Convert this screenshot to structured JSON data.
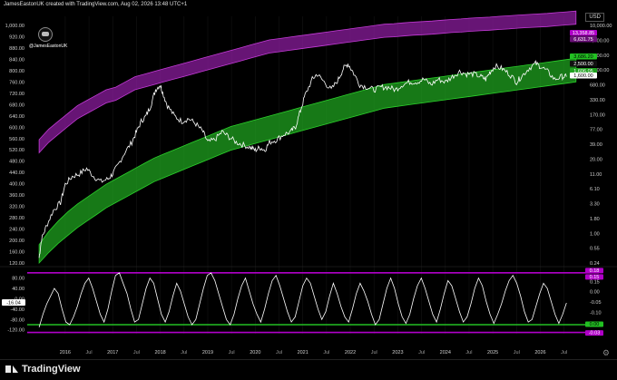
{
  "header": {
    "attribution": "JamesEastonUK created with TradingView.com, Aug 02, 2026 13:48 UTC+1"
  },
  "currency_badge": "USD",
  "avatar": {
    "handle": "@JamesEastonUK"
  },
  "footer": {
    "brand": "TradingView"
  },
  "colors": {
    "purple_band": "#8a1c9c",
    "green_band": "#1fa11f",
    "price": "#ffffff",
    "purple_line": "#b000c8",
    "green_line": "#22c022"
  },
  "chart_data": [
    {
      "type": "line",
      "title": "",
      "x": [
        2015.45,
        2015.5,
        2015.6,
        2015.75,
        2015.9,
        2016.0,
        2016.15,
        2016.3,
        2016.45,
        2016.6,
        2016.75,
        2016.9,
        2017.0,
        2017.1,
        2017.25,
        2017.4,
        2017.5,
        2017.6,
        2017.7,
        2017.8,
        2017.9,
        2018.0,
        2018.05,
        2018.15,
        2018.3,
        2018.45,
        2018.6,
        2018.75,
        2018.9,
        2019.0,
        2019.15,
        2019.3,
        2019.45,
        2019.6,
        2019.75,
        2019.9,
        2020.0,
        2020.1,
        2020.2,
        2020.3,
        2020.45,
        2020.6,
        2020.75,
        2020.85,
        2020.95,
        2021.05,
        2021.2,
        2021.3,
        2021.45,
        2021.6,
        2021.75,
        2021.85,
        2021.95,
        2022.05,
        2022.2,
        2022.35,
        2022.5,
        2022.65,
        2022.8,
        2022.95,
        2023.1,
        2023.25,
        2023.4,
        2023.55,
        2023.7,
        2023.85,
        2024.0,
        2024.15,
        2024.3,
        2024.45,
        2024.6,
        2024.75,
        2024.85,
        2024.95,
        2025.05,
        2025.2,
        2025.35,
        2025.5,
        2025.6,
        2025.75,
        2025.9,
        2026.0,
        2026.15,
        2026.3,
        2026.45,
        2026.55
      ],
      "series": [
        {
          "values": [
            120,
            190,
            240,
            300,
            330,
            400,
            430,
            440,
            460,
            430,
            410,
            420,
            440,
            470,
            520,
            560,
            600,
            640,
            660,
            700,
            760,
            780,
            750,
            700,
            660,
            640,
            650,
            630,
            600,
            560,
            570,
            600,
            580,
            560,
            550,
            540,
            530,
            540,
            530,
            560,
            570,
            590,
            600,
            620,
            680,
            740,
            800,
            820,
            790,
            760,
            800,
            840,
            860,
            830,
            780,
            770,
            760,
            770,
            770,
            760,
            780,
            790,
            790,
            800,
            780,
            800,
            790,
            810,
            830,
            820,
            820,
            810,
            800,
            830,
            850,
            840,
            820,
            790,
            810,
            840,
            860,
            850,
            830,
            800,
            810,
            810
          ]
        }
      ],
      "bands": [
        {
          "lower": [
            520,
            560,
            590,
            620,
            650,
            670,
            690,
            710,
            720,
            740,
            760,
            770,
            780,
            790,
            800,
            810,
            820,
            830,
            840,
            850,
            860,
            870,
            880,
            890,
            900,
            905,
            910,
            915,
            920,
            925,
            930,
            935,
            940,
            945,
            950,
            955,
            960,
            962,
            965,
            968,
            970,
            972,
            975,
            978,
            980,
            983,
            985,
            987,
            990,
            992,
            995,
            997,
            999,
            1001,
            1004,
            1007,
            1010
          ],
          "upper": [
            570,
            610,
            640,
            670,
            700,
            720,
            740,
            760,
            770,
            790,
            810,
            820,
            830,
            840,
            850,
            860,
            870,
            880,
            890,
            900,
            910,
            920,
            930,
            940,
            950,
            955,
            960,
            965,
            970,
            975,
            980,
            985,
            990,
            995,
            1000,
            1005,
            1010,
            1012,
            1015,
            1018,
            1020,
            1022,
            1025,
            1028,
            1030,
            1033,
            1035,
            1037,
            1040,
            1042,
            1045,
            1047,
            1049,
            1051,
            1054,
            1057,
            1060
          ]
        },
        {
          "lower": [
            100,
            140,
            175,
            205,
            235,
            260,
            285,
            310,
            330,
            350,
            370,
            390,
            410,
            425,
            440,
            455,
            470,
            485,
            500,
            515,
            530,
            540,
            550,
            560,
            570,
            580,
            590,
            600,
            610,
            620,
            630,
            640,
            650,
            660,
            670,
            680,
            690,
            695,
            700,
            705,
            710,
            715,
            720,
            725,
            730,
            735,
            740,
            745,
            750,
            755,
            760,
            765,
            770,
            775,
            780,
            785,
            790
          ],
          "upper": [
            170,
            220,
            260,
            295,
            325,
            350,
            375,
            400,
            420,
            440,
            460,
            480,
            500,
            515,
            530,
            545,
            560,
            575,
            590,
            605,
            620,
            630,
            640,
            650,
            660,
            670,
            680,
            690,
            700,
            710,
            720,
            730,
            740,
            750,
            760,
            770,
            780,
            785,
            790,
            795,
            800,
            805,
            810,
            815,
            820,
            825,
            830,
            835,
            840,
            845,
            850,
            855,
            860,
            865,
            870,
            875,
            880
          ]
        }
      ],
      "band_x_start": 2015.45,
      "band_x_end": 2026.75,
      "yticks_left": [
        "1,000.00",
        "920.00",
        "880.00",
        "840.00",
        "800.00",
        "760.00",
        "720.00",
        "680.00",
        "640.00",
        "600.00",
        "560.00",
        "520.00",
        "480.00",
        "440.00",
        "400.00",
        "360.00",
        "320.00",
        "280.00",
        "240.00",
        "200.00",
        "160.00",
        "120.00"
      ],
      "yticks_right": [
        "10,000.00",
        "5,000.00",
        "2,500.00",
        "1,300.00",
        "680.00",
        "330.00",
        "170.00",
        "77.00",
        "39.00",
        "20.00",
        "11.00",
        "6.10",
        "3.30",
        "1.80",
        "1.00",
        "0.55",
        "0.24"
      ],
      "price_labels": [
        {
          "text": "13,358.85",
          "color": "#b000c8"
        },
        {
          "text": "6,631.75",
          "color": "#6a1078"
        },
        {
          "text": "3,686.20",
          "color": "#22c022"
        },
        {
          "text": "2,500.00",
          "color": "#111111"
        },
        {
          "text": "1,606.05",
          "color": "#1fa11f"
        },
        {
          "text": "1,600.00",
          "color": "#ffffff"
        }
      ],
      "xticks": [
        "2016",
        "Jul",
        "2017",
        "Jul",
        "2018",
        "Jul",
        "2019",
        "Jul",
        "2020",
        "Jul",
        "2021",
        "Jul",
        "2022",
        "Jul",
        "2023",
        "Jul",
        "2024",
        "Jul",
        "2025",
        "Jul",
        "2026",
        "Jul"
      ],
      "xtick_years": [
        2016.0,
        2016.5,
        2017.0,
        2017.5,
        2018.0,
        2018.5,
        2019.0,
        2019.5,
        2020.0,
        2020.5,
        2021.0,
        2021.5,
        2022.0,
        2022.5,
        2023.0,
        2023.5,
        2024.0,
        2024.5,
        2025.0,
        2025.5,
        2026.0,
        2026.5
      ],
      "x_range": [
        2015.2,
        2026.85
      ],
      "ylim": [
        100,
        1040
      ],
      "log_scale_right": true
    },
    {
      "type": "line",
      "title": "",
      "yticks_left": [
        "80.00",
        "40.00",
        "0.00",
        "-40.00",
        "-80.00",
        "-120.00"
      ],
      "yticks_right": [
        "0.15",
        "0.00",
        "-0.05",
        "-0.10"
      ],
      "current_label": "-16.04",
      "right_labels": [
        {
          "text": "0.18",
          "color": "#b000c8"
        },
        {
          "text": "0.15",
          "color": "#b000c8"
        },
        {
          "text": "0.00",
          "color": "#22c022"
        },
        {
          "text": "-0.03",
          "color": "#b000c8"
        }
      ],
      "levels": [
        {
          "value": 100,
          "color": "#b000c8"
        },
        {
          "value": -100,
          "color": "#22c022"
        },
        {
          "value": -130,
          "color": "#b000c8"
        }
      ],
      "ylim": [
        -135,
        110
      ],
      "series": [
        {
          "values": [
            -110,
            -60,
            -20,
            10,
            40,
            20,
            -40,
            -90,
            -100,
            -70,
            -30,
            20,
            60,
            80,
            40,
            -10,
            -60,
            -90,
            -40,
            30,
            90,
            100,
            60,
            20,
            -40,
            -90,
            -80,
            -20,
            40,
            80,
            60,
            0,
            -60,
            -90,
            -50,
            10,
            60,
            30,
            -20,
            -70,
            -100,
            -80,
            -20,
            40,
            90,
            100,
            70,
            20,
            -30,
            -80,
            -100,
            -60,
            0,
            50,
            80,
            30,
            -20,
            -60,
            -90,
            -40,
            20,
            70,
            90,
            50,
            0,
            -50,
            -90,
            -70,
            -10,
            50,
            80,
            60,
            10,
            -40,
            -80,
            -50,
            10,
            60,
            20,
            -30,
            -70,
            -90,
            -40,
            20,
            60,
            30,
            -10,
            -60,
            -100,
            -80,
            -20,
            40,
            80,
            40,
            -20,
            -70,
            -95,
            -60,
            0,
            50,
            80,
            40,
            -10,
            -60,
            -90,
            -40,
            20,
            70,
            50,
            0,
            -50,
            -90,
            -70,
            -20,
            40,
            80,
            50,
            -10,
            -60,
            -95,
            -60,
            -20,
            30,
            70,
            90,
            60,
            10,
            -50,
            -90,
            -80,
            -30,
            20,
            60,
            40,
            -10,
            -60,
            -95,
            -60,
            -16
          ]
        }
      ]
    }
  ]
}
